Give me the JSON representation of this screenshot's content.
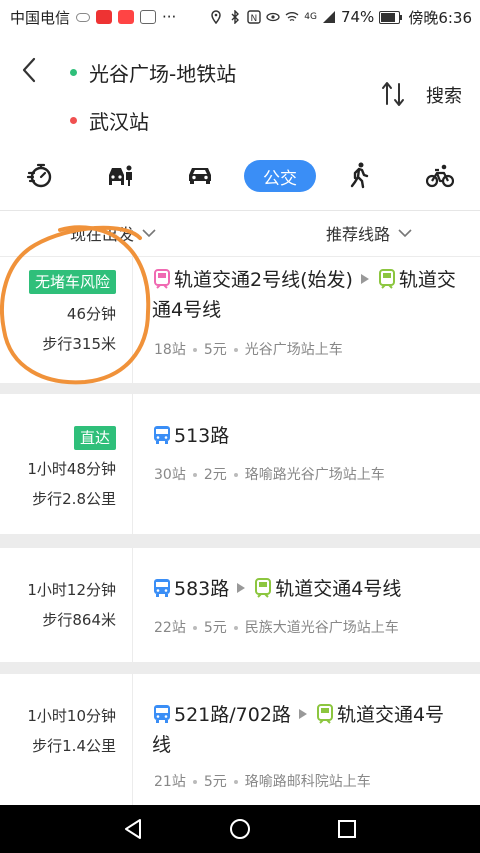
{
  "status_bar": {
    "carrier": "中国电信",
    "battery": "74%",
    "time": "傍晚6:36",
    "signal_text": "4G"
  },
  "header": {
    "origin": "光谷广场-地铁站",
    "destination": "武汉站",
    "search_label": "搜索",
    "origin_dot_color": "#2fbf7a",
    "destination_dot_color": "#f05050"
  },
  "modes": {
    "items": [
      "timer-icon",
      "car-taxi-icon",
      "car-icon",
      "公交",
      "walk-icon",
      "bike-icon"
    ],
    "active_label": "公交",
    "active_color": "#3a8ef6"
  },
  "filter": {
    "depart_label": "现在出发",
    "sort_label": "推荐线路"
  },
  "routes": [
    {
      "badge": "无堵车风险",
      "duration": "46分钟",
      "walk": "步行315米",
      "segments": [
        {
          "type": "metro",
          "name": "轨道交通2号线(始发)",
          "color": "#f06ab2"
        },
        {
          "type": "metro",
          "name": "轨道交通4号线",
          "color": "#8cc63f"
        }
      ],
      "stops": "18站",
      "price": "5元",
      "boarding": "光谷广场站上车"
    },
    {
      "badge": "直达",
      "duration": "1小时48分钟",
      "walk": "步行2.8公里",
      "segments": [
        {
          "type": "bus",
          "name": "513路",
          "color": "#3a8ef6"
        }
      ],
      "stops": "30站",
      "price": "2元",
      "boarding": "珞喻路光谷广场站上车"
    },
    {
      "badge": "",
      "duration": "1小时12分钟",
      "walk": "步行864米",
      "segments": [
        {
          "type": "bus",
          "name": "583路",
          "color": "#3a8ef6"
        },
        {
          "type": "metro",
          "name": "轨道交通4号线",
          "color": "#8cc63f"
        }
      ],
      "stops": "22站",
      "price": "5元",
      "boarding": "民族大道光谷广场站上车"
    },
    {
      "badge": "",
      "duration": "1小时10分钟",
      "walk": "步行1.4公里",
      "segments": [
        {
          "type": "bus",
          "name": "521路/702路",
          "color": "#3a8ef6"
        },
        {
          "type": "metro",
          "name": "轨道交通4号线",
          "color": "#8cc63f"
        }
      ],
      "stops": "21站",
      "price": "5元",
      "boarding": "珞喻路邮科院站上车"
    }
  ],
  "annotation_color": "#f0923a"
}
